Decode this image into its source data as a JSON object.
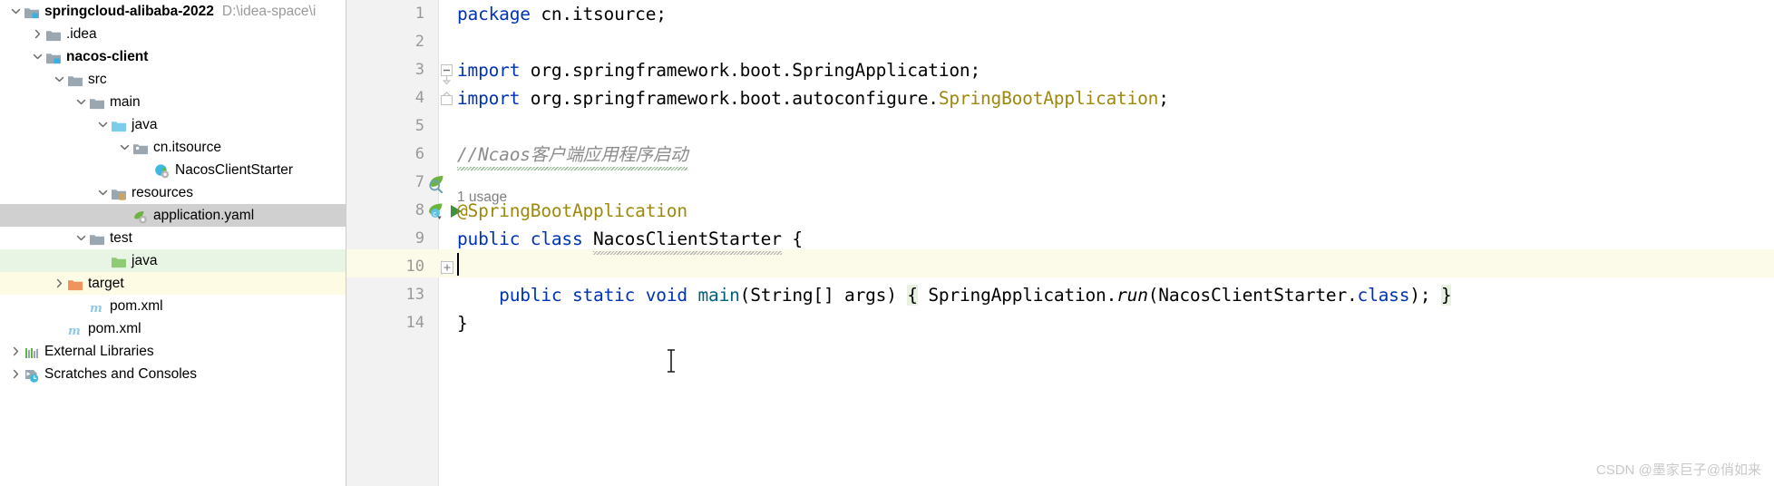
{
  "sidebar": {
    "name": "project-tree",
    "rows": [
      {
        "indent": 0,
        "chevron": "down",
        "icon": "module-folder-icon",
        "label": "springcloud-alibaba-2022",
        "bold": true,
        "path": "D:\\idea-space\\i",
        "bg": "none"
      },
      {
        "indent": 1,
        "chevron": "right",
        "icon": "folder-icon",
        "label": ".idea",
        "bold": false,
        "path": "",
        "bg": "none"
      },
      {
        "indent": 1,
        "chevron": "down",
        "icon": "module-folder-icon",
        "label": "nacos-client",
        "bold": true,
        "path": "",
        "bg": "none"
      },
      {
        "indent": 2,
        "chevron": "down",
        "icon": "folder-icon",
        "label": "src",
        "bold": false,
        "path": "",
        "bg": "none"
      },
      {
        "indent": 3,
        "chevron": "down",
        "icon": "folder-icon",
        "label": "main",
        "bold": false,
        "path": "",
        "bg": "none"
      },
      {
        "indent": 4,
        "chevron": "down",
        "icon": "source-folder-icon",
        "label": "java",
        "bold": false,
        "path": "",
        "bg": "none"
      },
      {
        "indent": 5,
        "chevron": "down",
        "icon": "package-icon",
        "label": "cn.itsource",
        "bold": false,
        "path": "",
        "bg": "none"
      },
      {
        "indent": 6,
        "chevron": "none",
        "icon": "java-class-icon",
        "label": "NacosClientStarter",
        "bold": false,
        "path": "",
        "bg": "none"
      },
      {
        "indent": 4,
        "chevron": "down",
        "icon": "resources-folder-icon",
        "label": "resources",
        "bold": false,
        "path": "",
        "bg": "none"
      },
      {
        "indent": 5,
        "chevron": "none",
        "icon": "yaml-file-icon",
        "label": "application.yaml",
        "bold": false,
        "path": "",
        "bg": "selected"
      },
      {
        "indent": 3,
        "chevron": "down",
        "icon": "folder-icon",
        "label": "test",
        "bold": false,
        "path": "",
        "bg": "none"
      },
      {
        "indent": 4,
        "chevron": "none",
        "icon": "test-source-folder-icon",
        "label": "java",
        "bold": false,
        "path": "",
        "bg": "green"
      },
      {
        "indent": 2,
        "chevron": "right",
        "icon": "target-folder-icon",
        "label": "target",
        "bold": false,
        "path": "",
        "bg": "yellow"
      },
      {
        "indent": 3,
        "chevron": "none",
        "icon": "maven-file-icon",
        "label": "pom.xml",
        "bold": false,
        "path": "",
        "bg": "none"
      },
      {
        "indent": 2,
        "chevron": "none",
        "icon": "maven-file-icon",
        "label": "pom.xml",
        "bold": false,
        "path": "",
        "bg": "none"
      },
      {
        "indent": 0,
        "chevron": "right",
        "icon": "external-libraries-icon",
        "label": "External Libraries",
        "bold": false,
        "path": "",
        "bg": "none"
      },
      {
        "indent": 0,
        "chevron": "right",
        "icon": "scratches-icon",
        "label": "Scratches and Consoles",
        "bold": false,
        "path": "",
        "bg": "none"
      }
    ]
  },
  "editor": {
    "name": "code-editor",
    "filename_class": "NacosClientStarter",
    "lines": [
      {
        "num": "1",
        "indent": 0,
        "caret_line": false,
        "fold": "none",
        "gutter_icon": "none",
        "inlay": "",
        "bg": "none"
      },
      {
        "num": "2",
        "indent": 0,
        "caret_line": false,
        "fold": "none",
        "gutter_icon": "none",
        "inlay": "",
        "bg": "none"
      },
      {
        "num": "3",
        "indent": 0,
        "caret_line": false,
        "fold": "region-start",
        "gutter_icon": "none",
        "inlay": "",
        "bg": "none"
      },
      {
        "num": "4",
        "indent": 0,
        "caret_line": false,
        "fold": "region-end",
        "gutter_icon": "none",
        "inlay": "",
        "bg": "none"
      },
      {
        "num": "5",
        "indent": 0,
        "caret_line": false,
        "fold": "none",
        "gutter_icon": "none",
        "inlay": "",
        "bg": "none"
      },
      {
        "num": "6",
        "indent": 0,
        "caret_line": false,
        "fold": "none",
        "gutter_icon": "none",
        "inlay": "",
        "bg": "none"
      },
      {
        "num": "7",
        "indent": 0,
        "caret_line": false,
        "fold": "none",
        "gutter_icon": "spring-bean-icon",
        "inlay": "1 usage",
        "bg": "none"
      },
      {
        "num": "8",
        "indent": 0,
        "caret_line": false,
        "fold": "none",
        "gutter_icon": "spring-run-icon",
        "inlay": "",
        "bg": "none"
      },
      {
        "num": "9",
        "indent": 0,
        "caret_line": true,
        "fold": "none",
        "gutter_icon": "none",
        "inlay": "",
        "bg": "caret"
      },
      {
        "num": "10",
        "indent": 1,
        "caret_line": false,
        "fold": "collapsed",
        "gutter_icon": "run-icon",
        "inlay": "",
        "bg": "none"
      },
      {
        "num": "13",
        "indent": 0,
        "caret_line": false,
        "fold": "none",
        "gutter_icon": "none",
        "inlay": "",
        "bg": "none"
      },
      {
        "num": "14",
        "indent": 0,
        "caret_line": false,
        "fold": "none",
        "gutter_icon": "none",
        "inlay": "",
        "bg": "none"
      }
    ],
    "code": {
      "l1_kw": "package",
      "l1_rest": " cn.itsource;",
      "l3_kw": "import",
      "l3_rest": " org.springframework.boot.SpringApplication;",
      "l4_kw": "import",
      "l4_mid": " org.springframework.boot.autoconfigure.",
      "l4_cls": "SpringBootApplication",
      "l4_end": ";",
      "l6_comment_latin": "//Ncaos",
      "l6_comment_cjk": "客户端应用程序启动",
      "l7_annotation": "@SpringBootApplication",
      "l7_inlay": "1 usage",
      "l8_kw1": "public",
      "l8_kw2": "class",
      "l8_name": "NacosClientStarter",
      "l8_brace": "{",
      "l10_kw1": "public",
      "l10_kw2": "static",
      "l10_kw3": "void",
      "l10_method": "main",
      "l10_params": "(String[] args) ",
      "l10_open_brace": "{",
      "l10_call_obj": " SpringApplication.",
      "l10_call_meth": "run",
      "l10_call_arg_open": "(NacosClientStarter.",
      "l10_class_kw": "class",
      "l10_call_end": "); ",
      "l10_close_brace": "}",
      "l13_brace": "}"
    }
  },
  "watermark": {
    "text": "CSDN @墨家巨子@俏如来"
  },
  "colors": {
    "keyword": "#0033b3",
    "annotation": "#9e880d",
    "comment": "#8c8c8c",
    "method": "#00627a",
    "selection_bg": "#d0d0d0",
    "caret_line_bg": "#fcfae8",
    "test_source_bg": "#e9f5e4",
    "excluded_bg": "#fdfbe3",
    "gutter_bg": "#f2f2f2"
  }
}
